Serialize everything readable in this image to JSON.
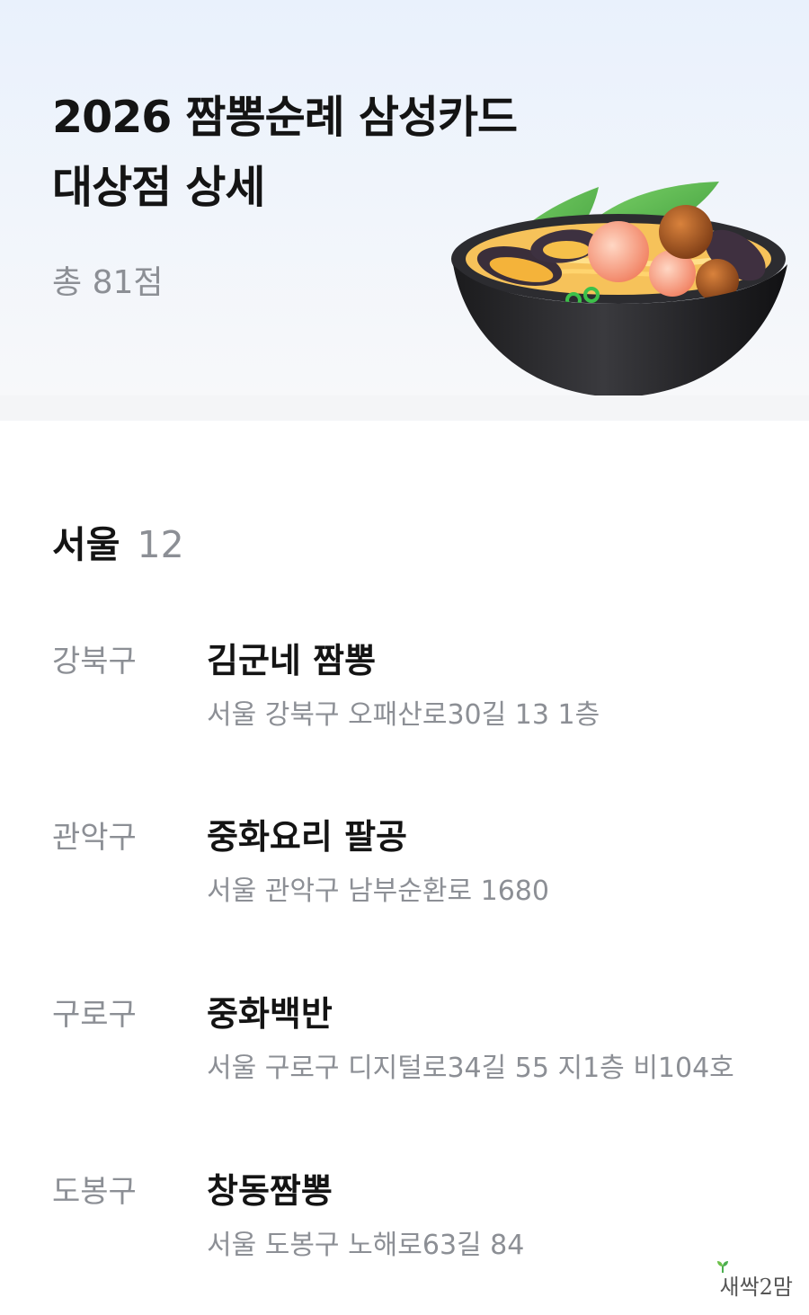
{
  "header": {
    "title_line1": "2026 짬뽕순례 삼성카드",
    "title_line2": "대상점 상세",
    "total": "총 81점"
  },
  "hero_image": "jjamppong-bowl-illustration",
  "region": {
    "name": "서울",
    "count": "12"
  },
  "stores": [
    {
      "district": "강북구",
      "name": "김군네 짬뽕",
      "address": "서울 강북구 오패산로30길 13 1층"
    },
    {
      "district": "관악구",
      "name": "중화요리 팔공",
      "address": "서울 관악구 남부순환로 1680"
    },
    {
      "district": "구로구",
      "name": "중화백반",
      "address": "서울 구로구 디지털로34길 55 지1층 비104호"
    },
    {
      "district": "도봉구",
      "name": "창동짬뽕",
      "address": "서울 도봉구 노해로63길 84"
    }
  ],
  "watermark": "새싹2맘"
}
